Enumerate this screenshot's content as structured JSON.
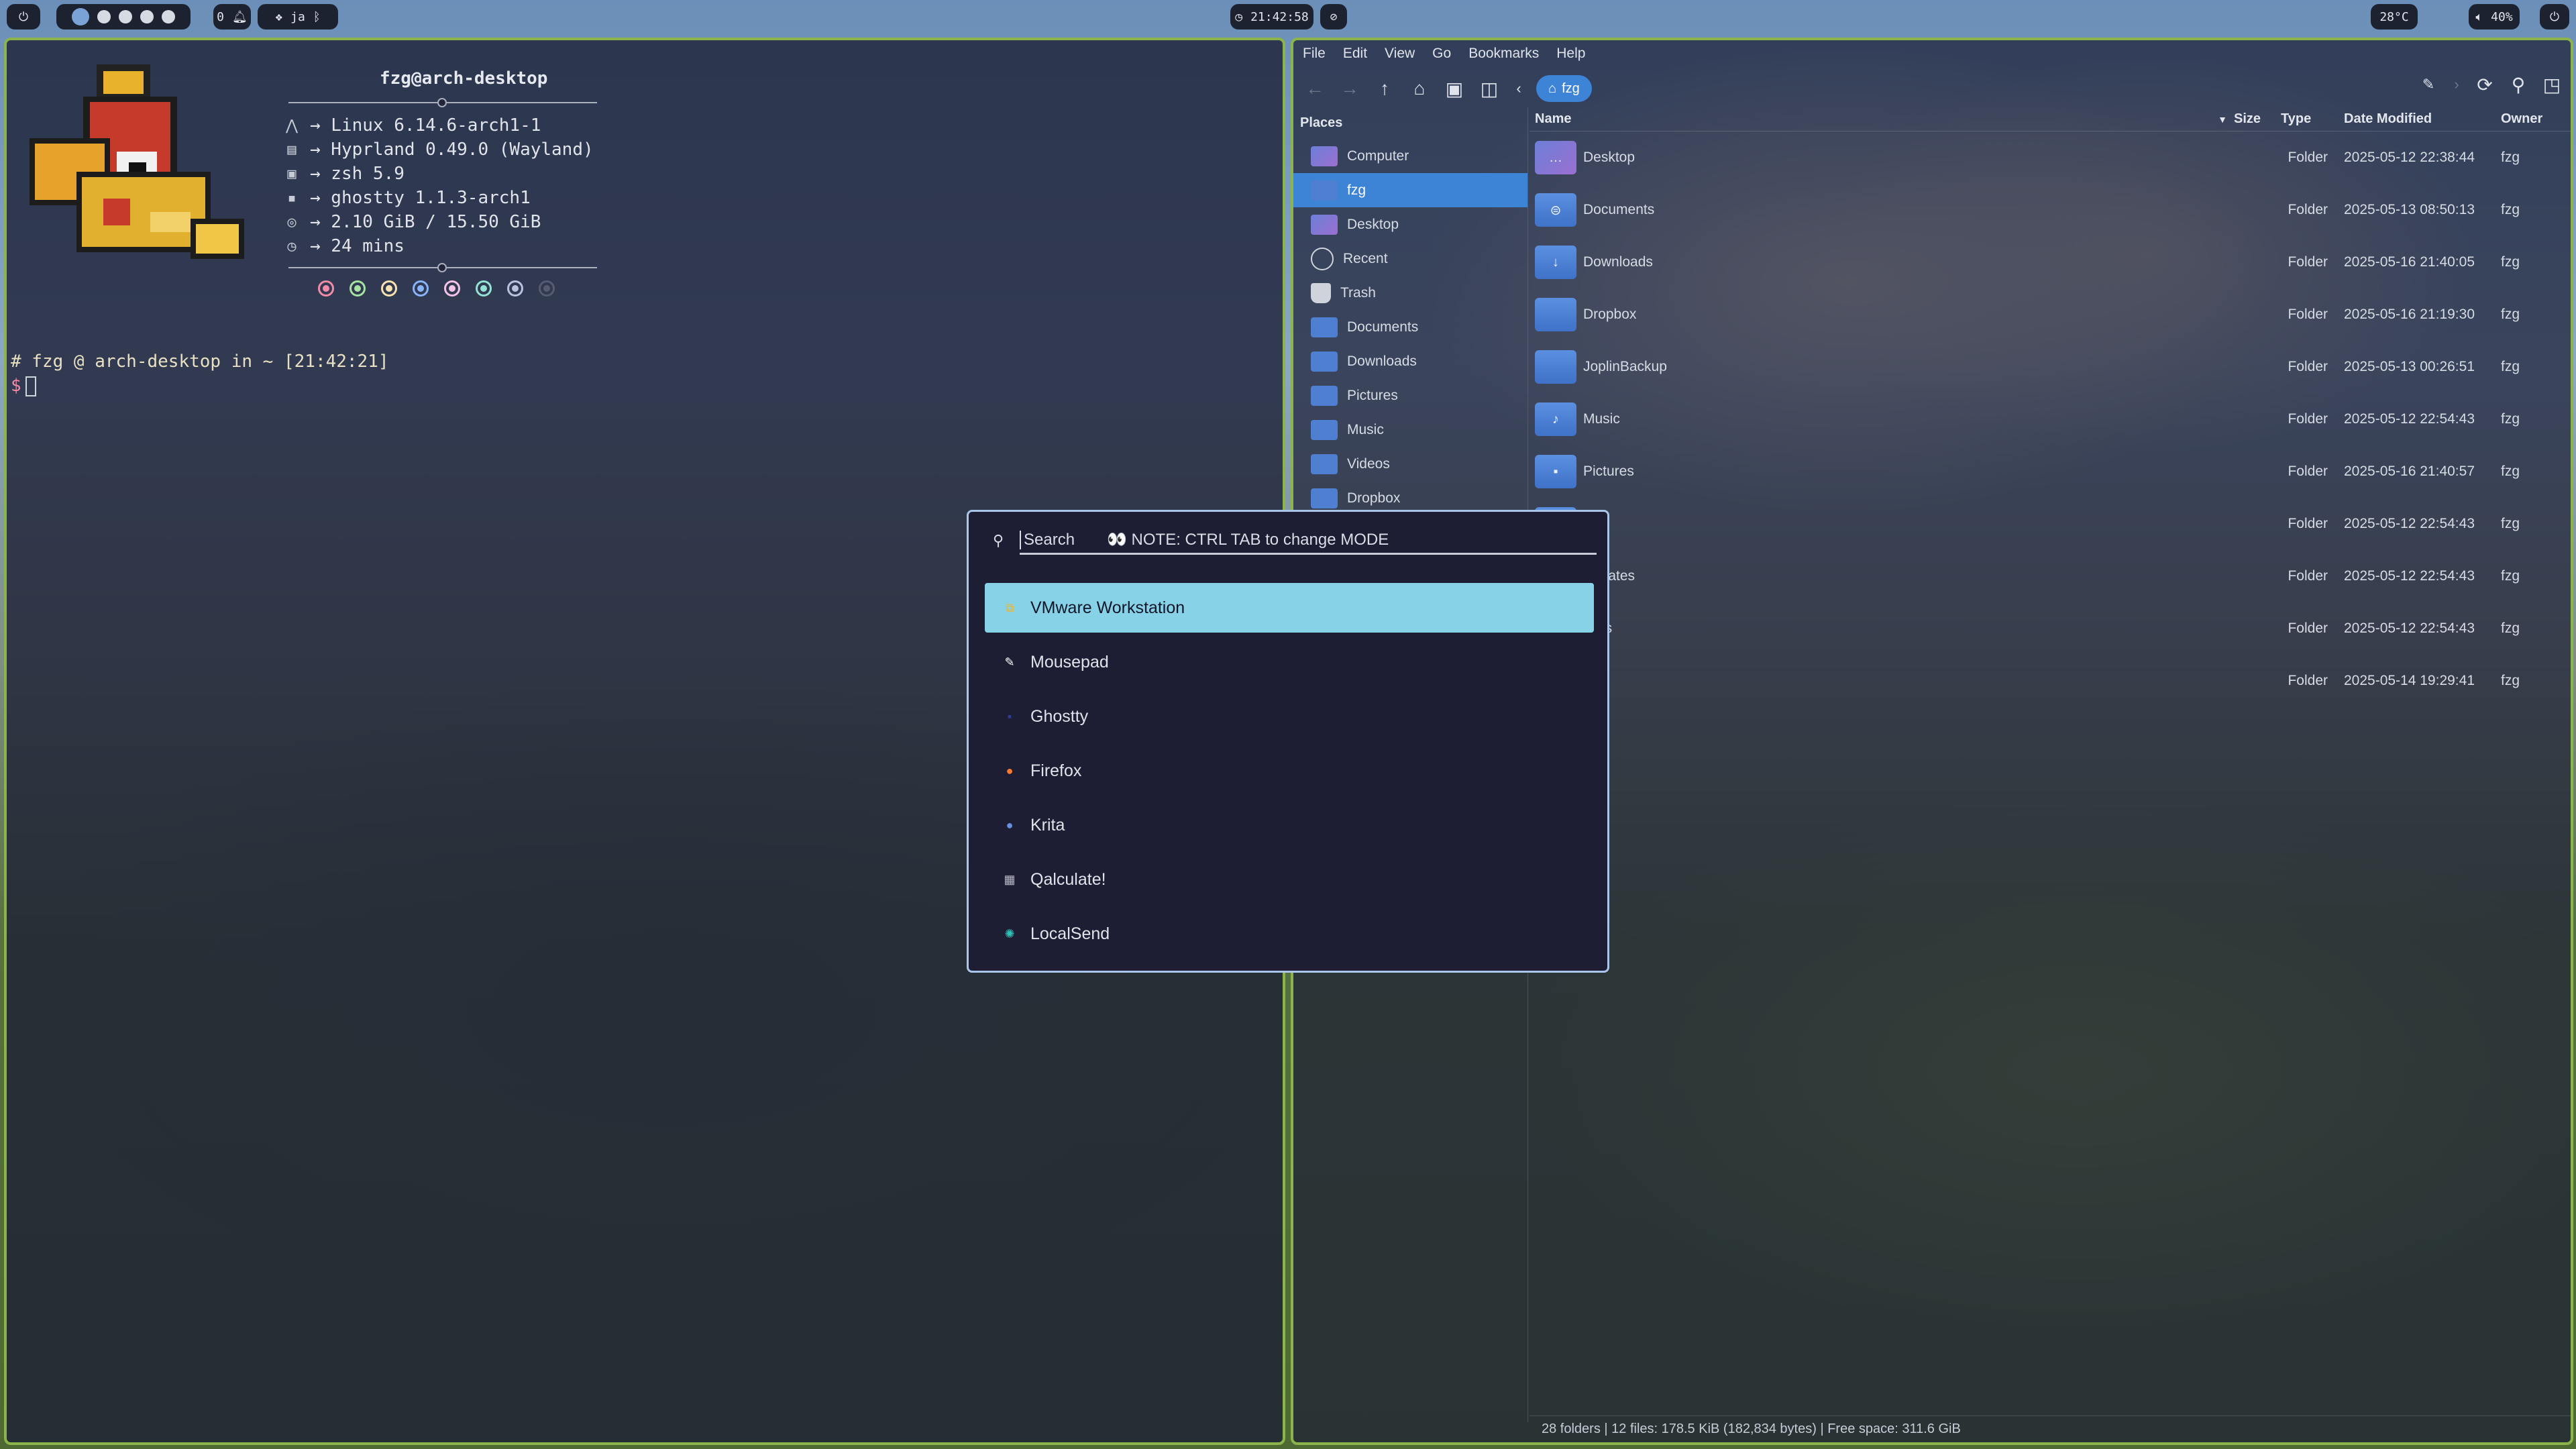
{
  "topbar": {
    "left_icon": "arch-icon",
    "notifications": "0",
    "lang": "ja",
    "clock": "21:42:58",
    "weather": "28°C",
    "volume": "40%"
  },
  "terminal": {
    "title": "fzg@arch-desktop",
    "info": [
      {
        "icon": "arch-icon",
        "glyph": "⋀",
        "text": "→ Linux 6.14.6-arch1-1"
      },
      {
        "icon": "window-icon",
        "glyph": "▤",
        "text": "→ Hyprland 0.49.0 (Wayland)"
      },
      {
        "icon": "shell-icon",
        "glyph": "▣",
        "text": "→ zsh 5.9"
      },
      {
        "icon": "terminal-icon",
        "glyph": "▪",
        "text": "→ ghostty 1.1.3-arch1"
      },
      {
        "icon": "memory-icon",
        "glyph": "◎",
        "text": "→ 2.10 GiB / 15.50 GiB"
      },
      {
        "icon": "clock-icon",
        "glyph": "◷",
        "text": "→ 24 mins"
      }
    ],
    "palette": [
      "#f38ba8",
      "#a6e3a1",
      "#f9e2af",
      "#89b4fa",
      "#f5c2e7",
      "#94e2d5",
      "#bac2de",
      "#585b70"
    ],
    "prompt_line": "# fzg @ arch-desktop in ~ [21:42:21]",
    "prompt_symbol": "$"
  },
  "filemanager": {
    "menu": [
      "File",
      "Edit",
      "View",
      "Go",
      "Bookmarks",
      "Help"
    ],
    "breadcrumb": "fzg",
    "places_header": "Places",
    "places": [
      {
        "label": "Computer",
        "icon": "computer-icon"
      },
      {
        "label": "fzg",
        "icon": "home-icon",
        "selected": true
      },
      {
        "label": "Desktop",
        "icon": "desktop-icon"
      },
      {
        "label": "Recent",
        "icon": "recent-icon"
      },
      {
        "label": "Trash",
        "icon": "trash-icon"
      },
      {
        "label": "Documents",
        "icon": "documents-icon"
      },
      {
        "label": "Downloads",
        "icon": "downloads-icon"
      },
      {
        "label": "Pictures",
        "icon": "pictures-icon"
      },
      {
        "label": "Music",
        "icon": "music-icon"
      },
      {
        "label": "Videos",
        "icon": "videos-icon"
      },
      {
        "label": "Dropbox",
        "icon": "dropbox-icon"
      }
    ],
    "columns": {
      "name": "Name",
      "size": "Size",
      "type": "Type",
      "date": "Date Modified",
      "owner": "Owner"
    },
    "rows": [
      {
        "name": "Desktop",
        "glyph": "…",
        "type": "Folder",
        "date": "2025-05-12 22:38:44",
        "owner": "fzg"
      },
      {
        "name": "Documents",
        "glyph": "⊜",
        "type": "Folder",
        "date": "2025-05-13 08:50:13",
        "owner": "fzg"
      },
      {
        "name": "Downloads",
        "glyph": "↓",
        "type": "Folder",
        "date": "2025-05-16 21:40:05",
        "owner": "fzg"
      },
      {
        "name": "Dropbox",
        "glyph": "",
        "type": "Folder",
        "date": "2025-05-16 21:19:30",
        "owner": "fzg"
      },
      {
        "name": "JoplinBackup",
        "glyph": "",
        "type": "Folder",
        "date": "2025-05-13 00:26:51",
        "owner": "fzg"
      },
      {
        "name": "Music",
        "glyph": "♪",
        "type": "Folder",
        "date": "2025-05-12 22:54:43",
        "owner": "fzg"
      },
      {
        "name": "Pictures",
        "glyph": "▪",
        "type": "Folder",
        "date": "2025-05-16 21:40:57",
        "owner": "fzg"
      },
      {
        "name": "…ic",
        "glyph": "",
        "type": "Folder",
        "date": "2025-05-12 22:54:43",
        "owner": "fzg"
      },
      {
        "name": "…plates",
        "glyph": "",
        "type": "Folder",
        "date": "2025-05-12 22:54:43",
        "owner": "fzg"
      },
      {
        "name": "…os",
        "glyph": "",
        "type": "Folder",
        "date": "2025-05-12 22:54:43",
        "owner": "fzg"
      },
      {
        "name": "",
        "glyph": "",
        "type": "Folder",
        "date": "2025-05-14 19:29:41",
        "owner": "fzg"
      }
    ],
    "status": "28 folders  |  12 files: 178.5 KiB (182,834 bytes)  |  Free space: 311.6 GiB"
  },
  "launcher": {
    "search_placeholder": "Search",
    "note": "👀 NOTE: CTRL TAB to change MODE",
    "items": [
      {
        "label": "VMware Workstation",
        "icon": "vmware-icon",
        "glyph": "⧉",
        "color": "#e8b730",
        "selected": true
      },
      {
        "label": "Mousepad",
        "icon": "mousepad-icon",
        "glyph": "✎",
        "color": "#ffffff"
      },
      {
        "label": "Ghostty",
        "icon": "ghostty-icon",
        "glyph": "▪",
        "color": "#2b3f9a"
      },
      {
        "label": "Firefox",
        "icon": "firefox-icon",
        "glyph": "●",
        "color": "#ff7a2e"
      },
      {
        "label": "Krita",
        "icon": "krita-icon",
        "glyph": "●",
        "color": "#6a8ee0"
      },
      {
        "label": "Qalculate!",
        "icon": "qalculate-icon",
        "glyph": "▦",
        "color": "#b8b8c8"
      },
      {
        "label": "LocalSend",
        "icon": "localsend-icon",
        "glyph": "✺",
        "color": "#2fc4b8"
      }
    ]
  }
}
